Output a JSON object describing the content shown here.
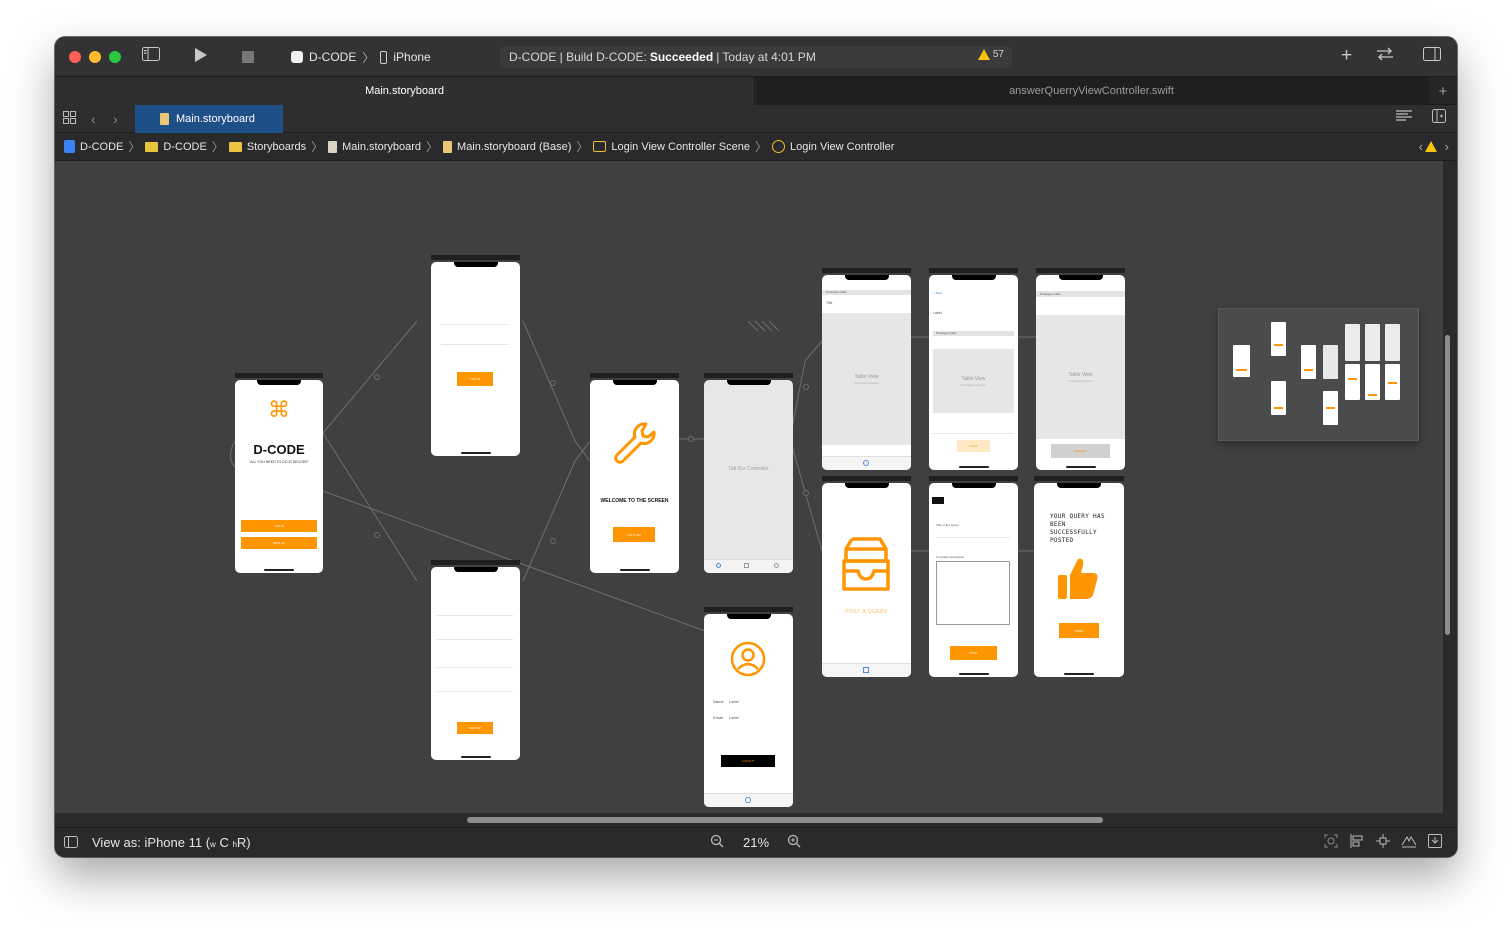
{
  "toolbar": {
    "scheme_name": "D-CODE",
    "device_name": "iPhone",
    "status_prefix": "D-CODE | Build D-CODE:",
    "status_result": "Succeeded",
    "status_suffix": "| Today at 4:01 PM",
    "warning_count": "57"
  },
  "tabs": [
    {
      "label": "Main.storyboard"
    },
    {
      "label": "answerQuerryViewController.swift"
    }
  ],
  "file_tab": "Main.storyboard",
  "breadcrumb": [
    {
      "label": "D-CODE"
    },
    {
      "label": "D-CODE"
    },
    {
      "label": "Storyboards"
    },
    {
      "label": "Main.storyboard"
    },
    {
      "label": "Main.storyboard (Base)"
    },
    {
      "label": "Login View Controller Scene"
    },
    {
      "label": "Login View Controller"
    }
  ],
  "scenes": {
    "home": {
      "logo": "⌘",
      "title": "D-CODE",
      "tagline": "\"ALL YOU NEED TO DO IS DECODE\"",
      "btn1": "LOG IN",
      "btn2": "SIGN UP"
    },
    "login": {
      "btn": "LOG IN"
    },
    "signup": {
      "btn": "SIGN UP"
    },
    "welcome": {
      "title": "WELCOME TO THE SCREEN",
      "btn": "LET'S GO"
    },
    "tabbar": {
      "label": "Tab Bar Controller"
    },
    "profile": {
      "name_label": "Name",
      "name_value": "Label",
      "email_label": "Email",
      "email_value": "Label",
      "btn": "LOGOUT"
    },
    "queries": {
      "cell": "Prototype Cells",
      "title": "Title",
      "tv": "Table View",
      "tv_sub": "Prototype Content"
    },
    "answer": {
      "back": "< Back",
      "label": "Label",
      "cell": "Prototype Cells",
      "tv": "Table View",
      "tv_sub": "Prototype Content",
      "btn": "POST"
    },
    "my_queries": {
      "cell": "Prototype Cells",
      "tv": "Table View",
      "tv_sub": "Prototype Content",
      "btn": "DELETE"
    },
    "post": {
      "caption": "POST A QUERY"
    },
    "ask": {
      "title_label": "Title of the Query",
      "desc_label": "Complete description",
      "btn": "POST"
    },
    "success": {
      "message": "YOUR QUERY HAS BEEN SUCCESSFULLY POSTED",
      "btn": "DONE"
    }
  },
  "bottom": {
    "view_as": "View as: iPhone 11 (",
    "size_w": "w",
    "size_c": "C",
    "size_h": "h",
    "size_r": "R)",
    "zoom": "21%"
  },
  "colors": {
    "accent": "#ff9500",
    "canvas": "#404042",
    "success_green": "#28c840"
  }
}
